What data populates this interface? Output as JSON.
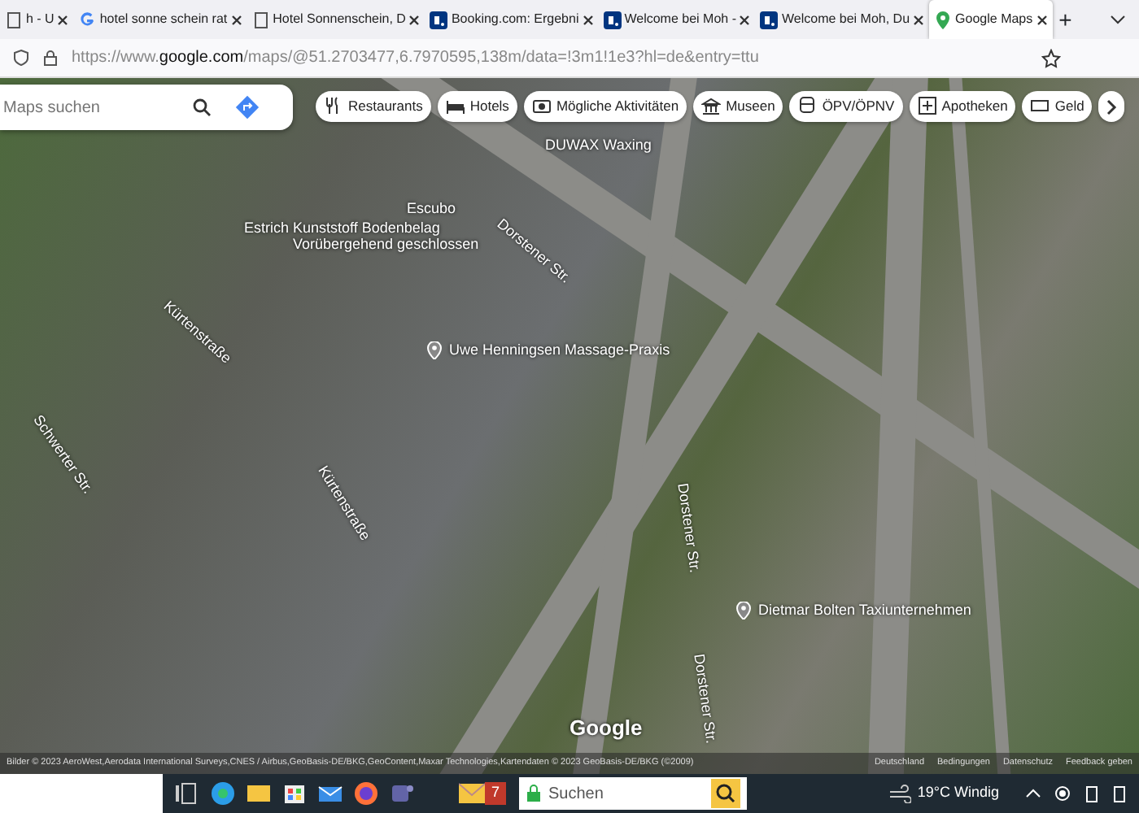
{
  "tabs": [
    {
      "title": "h - U",
      "kind": "page",
      "selected": false
    },
    {
      "title": "hotel sonne schein rat",
      "kind": "google",
      "selected": false
    },
    {
      "title": "Hotel Sonnenschein, D",
      "kind": "page",
      "selected": false
    },
    {
      "title": "Booking.com: Ergebni",
      "kind": "booking",
      "selected": false
    },
    {
      "title": "Welcome bei Moh -",
      "kind": "booking",
      "selected": false
    },
    {
      "title": "Welcome bei Moh, Du",
      "kind": "booking",
      "selected": false
    },
    {
      "title": "Google Maps",
      "kind": "maps",
      "selected": true
    }
  ],
  "new_tab": "+",
  "address_bar": {
    "url_prefix": "https://www.",
    "url_domain": "google.com",
    "url_rest": "/maps/@51.2703477,6.7970595,138m/data=!3m1!1e3?hl=de&entry=ttu"
  },
  "map": {
    "search": {
      "placeholder": "Maps suchen"
    },
    "chips": [
      "Restaurants",
      "Hotels",
      "Mögliche Aktivitäten",
      "Museen",
      "ÖPV/ÖPNV",
      "Apotheken",
      "Geld"
    ],
    "places": [
      {
        "name": "DUWAX Waxing",
        "pin": false
      },
      {
        "name": "Escubo",
        "pin": false
      },
      {
        "name": "Estrich Kunststoff Bodenbelag",
        "pin": false
      },
      {
        "name": "Vorübergehend geschlossen",
        "pin": false
      },
      {
        "name": "Uwe Henningsen Massage-Praxis",
        "pin": true
      },
      {
        "name": "Dietmar Bolten Taxiunternehmen",
        "pin": true
      }
    ],
    "streets": [
      "Kürtenstraße",
      "Kürtenstraße",
      "Dorstener Str.",
      "Dorstener Str.",
      "Dorstener Str.",
      "Schwerter Str."
    ],
    "logo": "Google",
    "attribution": "Bilder © 2023 AeroWest,Aerodata International Surveys,CNES / Airbus,GeoBasis-DE/BKG,GeoContent,Maxar Technologies,Kartendaten © 2023 GeoBasis-DE/BKG (©2009)",
    "footer_links": [
      "Deutschland",
      "Bedingungen",
      "Datenschutz",
      "Feedback geben"
    ]
  },
  "taskbar": {
    "mail_count": "7",
    "search_placeholder": "Suchen",
    "weather": "19°C Windig"
  }
}
